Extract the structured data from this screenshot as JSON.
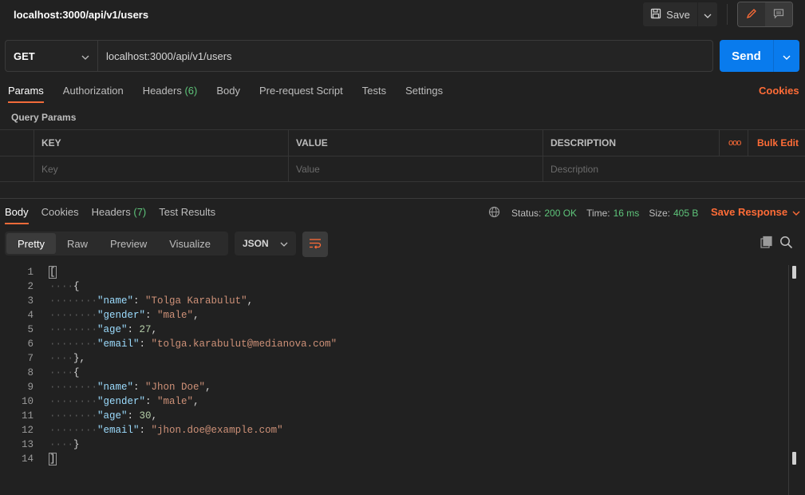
{
  "header": {
    "title": "localhost:3000/api/v1/users",
    "save_label": "Save"
  },
  "request": {
    "method": "GET",
    "url": "localhost:3000/api/v1/users",
    "send_label": "Send",
    "tabs": [
      {
        "label": "Params",
        "active": true
      },
      {
        "label": "Authorization"
      },
      {
        "label": "Headers",
        "count": "(6)"
      },
      {
        "label": "Body"
      },
      {
        "label": "Pre-request Script"
      },
      {
        "label": "Tests"
      },
      {
        "label": "Settings"
      }
    ],
    "cookies_label": "Cookies"
  },
  "query_params": {
    "title": "Query Params",
    "headers": {
      "key": "KEY",
      "value": "VALUE",
      "description": "DESCRIPTION",
      "more": "ooo",
      "bulk_edit": "Bulk Edit"
    },
    "placeholders": {
      "key": "Key",
      "value": "Value",
      "description": "Description"
    }
  },
  "response": {
    "tabs": [
      {
        "label": "Body",
        "active": true
      },
      {
        "label": "Cookies"
      },
      {
        "label": "Headers",
        "count": "(7)"
      },
      {
        "label": "Test Results"
      }
    ],
    "status_label": "Status:",
    "status_value": "200 OK",
    "time_label": "Time:",
    "time_value": "16 ms",
    "size_label": "Size:",
    "size_value": "405 B",
    "save_response_label": "Save Response",
    "views": [
      "Pretty",
      "Raw",
      "Preview",
      "Visualize"
    ],
    "active_view": "Pretty",
    "format": "JSON"
  },
  "code_lines": [
    {
      "n": "1",
      "indent": 0,
      "parts": [
        [
          "punc",
          "["
        ]
      ]
    },
    {
      "n": "2",
      "indent": 1,
      "parts": [
        [
          "punc",
          "{"
        ]
      ]
    },
    {
      "n": "3",
      "indent": 2,
      "parts": [
        [
          "key",
          "\"name\""
        ],
        [
          "punc",
          ": "
        ],
        [
          "str",
          "\"Tolga Karabulut\""
        ],
        [
          "punc",
          ","
        ]
      ]
    },
    {
      "n": "4",
      "indent": 2,
      "parts": [
        [
          "key",
          "\"gender\""
        ],
        [
          "punc",
          ": "
        ],
        [
          "str",
          "\"male\""
        ],
        [
          "punc",
          ","
        ]
      ]
    },
    {
      "n": "5",
      "indent": 2,
      "parts": [
        [
          "key",
          "\"age\""
        ],
        [
          "punc",
          ": "
        ],
        [
          "num",
          "27"
        ],
        [
          "punc",
          ","
        ]
      ]
    },
    {
      "n": "6",
      "indent": 2,
      "parts": [
        [
          "key",
          "\"email\""
        ],
        [
          "punc",
          ": "
        ],
        [
          "str",
          "\"tolga.karabulut@medianova.com\""
        ]
      ]
    },
    {
      "n": "7",
      "indent": 1,
      "parts": [
        [
          "punc",
          "},"
        ]
      ]
    },
    {
      "n": "8",
      "indent": 1,
      "parts": [
        [
          "punc",
          "{"
        ]
      ]
    },
    {
      "n": "9",
      "indent": 2,
      "parts": [
        [
          "key",
          "\"name\""
        ],
        [
          "punc",
          ": "
        ],
        [
          "str",
          "\"Jhon Doe\""
        ],
        [
          "punc",
          ","
        ]
      ]
    },
    {
      "n": "10",
      "indent": 2,
      "parts": [
        [
          "key",
          "\"gender\""
        ],
        [
          "punc",
          ": "
        ],
        [
          "str",
          "\"male\""
        ],
        [
          "punc",
          ","
        ]
      ]
    },
    {
      "n": "11",
      "indent": 2,
      "parts": [
        [
          "key",
          "\"age\""
        ],
        [
          "punc",
          ": "
        ],
        [
          "num",
          "30"
        ],
        [
          "punc",
          ","
        ]
      ]
    },
    {
      "n": "12",
      "indent": 2,
      "parts": [
        [
          "key",
          "\"email\""
        ],
        [
          "punc",
          ": "
        ],
        [
          "str",
          "\"jhon.doe@example.com\""
        ]
      ]
    },
    {
      "n": "13",
      "indent": 1,
      "parts": [
        [
          "punc",
          "}"
        ]
      ]
    },
    {
      "n": "14",
      "indent": 0,
      "parts": [
        [
          "punc",
          "]"
        ]
      ]
    }
  ],
  "colors": {
    "accent": "#ff6c37",
    "send": "#097bed",
    "success": "#5ec47a"
  },
  "icons": [
    "save-icon",
    "chevron-down-icon",
    "pencil-icon",
    "comment-icon",
    "globe-icon",
    "wrap-lines-icon",
    "copy-icon",
    "search-icon"
  ]
}
